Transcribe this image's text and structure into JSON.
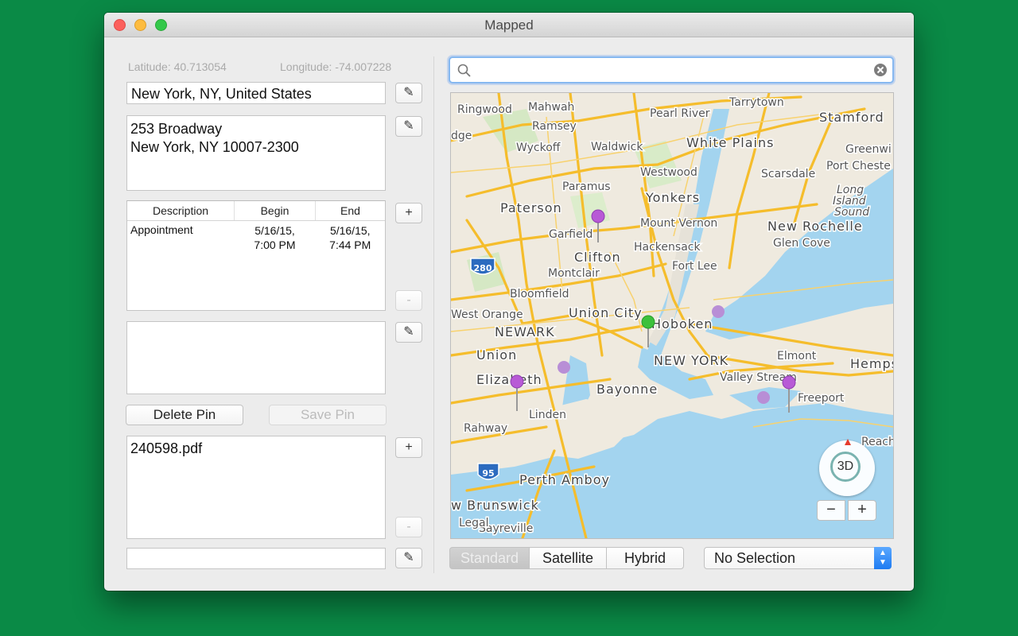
{
  "window": {
    "title": "Mapped"
  },
  "location": {
    "latitude_text": "Latitude: 40.713054",
    "longitude_text": "Longitude: -74.007228",
    "name": "New York, NY, United States",
    "address_line1": "253 Broadway",
    "address_line2": "New York, NY  10007-2300"
  },
  "events": {
    "columns": [
      "Description",
      "Begin",
      "End"
    ],
    "rows": [
      {
        "description": "Appointment",
        "begin_date": "5/16/15,",
        "begin_time": "7:00 PM",
        "end_date": "5/16/15,",
        "end_time": "7:44 PM"
      }
    ]
  },
  "buttons": {
    "edit_icon": "✎",
    "add": "+",
    "remove": "-",
    "delete_pin": "Delete Pin",
    "save_pin": "Save Pin"
  },
  "attachments": {
    "items": [
      "240598.pdf"
    ]
  },
  "search": {
    "placeholder": "",
    "value": ""
  },
  "map": {
    "labels": [
      "Ringwood",
      "Mahwah",
      "Tarrytown",
      "Pearl River",
      "Stamford",
      "Ramsey",
      "dge",
      "Wyckoff",
      "Waldwick",
      "White Plains",
      "Greenwi",
      "Port Cheste",
      "Westwood",
      "Scarsdale",
      "Paramus",
      "Yonkers",
      "Long",
      "Island",
      "Sound",
      "Paterson",
      "Mount Vernon",
      "New Rochelle",
      "Garfield",
      "Hackensack",
      "Glen Cove",
      "Clifton",
      "Fort Lee",
      "Montclair",
      "Bloomfield",
      "West Orange",
      "Union City",
      "NEWARK",
      "Hoboken",
      "Union",
      "NEW YORK",
      "Elmont",
      "Hemps",
      "Valley Stream",
      "Elizabeth",
      "Bayonne",
      "Freeport",
      "Linden",
      "Rahway",
      "Perth Amboy",
      "w Brunswick",
      "Sayreville",
      "Legal",
      "Reach",
      "280",
      "95"
    ],
    "compass_label": "3D",
    "zoom_out": "−",
    "zoom_in": "+"
  },
  "map_types": {
    "options": [
      "Standard",
      "Satellite",
      "Hybrid"
    ],
    "selected": "Standard"
  },
  "selection_popup": {
    "value": "No Selection"
  },
  "colors": {
    "pin_purple": "#b85ad6",
    "pin_green": "#3cc13c",
    "water": "#a3d4ef",
    "road": "#f5bd2c",
    "background": "#0a8a46"
  }
}
